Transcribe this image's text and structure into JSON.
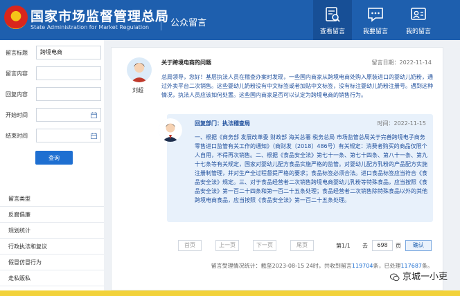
{
  "header": {
    "title_cn": "国家市场监督管理总局",
    "title_en": "State Administration for Market Regulation",
    "section": "公众留言",
    "nav": [
      {
        "label": "查看留言",
        "icon": "view-message-icon",
        "active": true
      },
      {
        "label": "我要留言",
        "icon": "write-message-icon",
        "active": false
      },
      {
        "label": "我的留言",
        "icon": "my-message-icon",
        "active": false
      }
    ]
  },
  "filters": {
    "fields": [
      {
        "label": "留言标题",
        "value": "跨境电商"
      },
      {
        "label": "留言内容",
        "value": ""
      },
      {
        "label": "回复内容",
        "value": ""
      },
      {
        "label": "开始时间",
        "value": ""
      },
      {
        "label": "结束时间",
        "value": ""
      }
    ],
    "query_label": "查询"
  },
  "categories": [
    "留言类型",
    "反腐倡廉",
    "规划统计",
    "行政执法和复议",
    "假冒仿冒行为",
    "走私贩私"
  ],
  "message": {
    "author": "刘超",
    "title": "关于跨境电商的问题",
    "date": "留言日期：2022-11-14",
    "body": "总局领导，您好！基层执法人员在稽查办案时发现，一些国内商家从跨境电商处购入原装进口的婴幼儿奶粉，通过外卖平台二次销售。这些婴幼儿奶粉没有中文标签或者加贴中文标签，没有标注婴幼儿奶粉注册号。遇到这种情况，执法人员应该如何处置。这些国内商家是否可以认定为跨境电商的销售行为。"
  },
  "reply": {
    "dept": "回复部门：执法稽查局",
    "time": "时间：2022-11-15",
    "body": "一、根据《商务部 发展改革委 财政部 海关总署 税务总局 市场监管总局关于完善跨境电子商务零售进口监管有关工作的通知》（商财发〔2018〕486号）有关规定：消费者购买的商品仅限个人自用，不得再次销售。二、根据《食品安全法》第七十一条、第七十四条、第八十一条、第九十七条等有关规定，国家对婴幼儿配方食品实施严格的监管。对婴幼儿配方乳粉的产品配方实施注册制管理，并对生产全过程督提严格的要求；食品标签必须合法。进口食品标签应当符合《食品安全法》规定。三、对于食品经营者二次销售跨境电商婴幼儿乳粉等特殊食品，应当按照《食品安全法》第一百二十四条和第一百二十五条处理；食品经营者二次销售除特殊食品以外的其他跨境电商食品，应当按照《食品安全法》第一百二十五条处理。"
  },
  "pager": {
    "first": "首页",
    "prev": "上一页",
    "next": "下一页",
    "last": "尾页",
    "page_info": "第1/1",
    "goto_label": "去",
    "goto_value": "698",
    "page_unit": "页",
    "confirm": "确认"
  },
  "stats": {
    "prefix": "留言受理情况统计：截至2023-08-15 24时，共收到留言",
    "received": "119704",
    "mid": "条，已处理",
    "processed": "117687",
    "suffix": "条。"
  },
  "watermark": "京城一小吏"
}
